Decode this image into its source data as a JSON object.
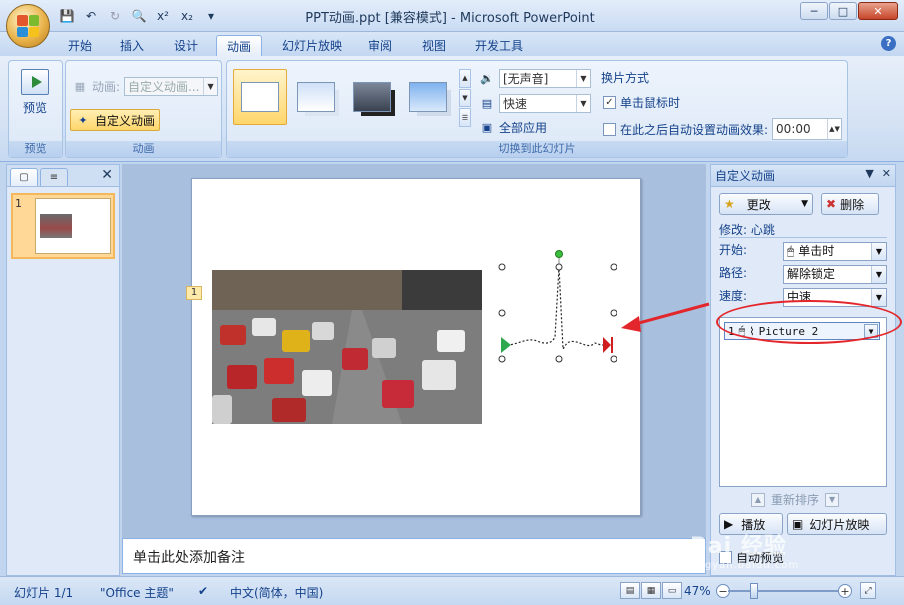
{
  "window": {
    "title": "PPT动画.ppt [兼容模式] - Microsoft PowerPoint",
    "controls": [
      "─",
      "□",
      "✕"
    ]
  },
  "qat": {
    "items": [
      "save-icon",
      "undo-icon",
      "redo-icon",
      "print-preview-icon",
      "superscript-icon",
      "subscript-icon",
      "customize-icon"
    ],
    "superscript": "x²",
    "subscript": "x₂"
  },
  "tabs": [
    "开始",
    "插入",
    "设计",
    "动画",
    "幻灯片放映",
    "审阅",
    "视图",
    "开发工具"
  ],
  "active_tab": "动画",
  "ribbon": {
    "preview_group": {
      "button": "预览",
      "label": "预览"
    },
    "animation_group": {
      "label": "动画",
      "animate_label": "动画:",
      "animate_value": "自定义动画...",
      "custom_animation_button": "自定义动画"
    },
    "transition_group": {
      "label": "切换到此幻灯片",
      "sound": "[无声音]",
      "speed": "快速",
      "apply_all": "全部应用",
      "advance_title": "换片方式",
      "on_click": "单击鼠标时",
      "on_click_checked": true,
      "after_label": "在此之后自动设置动画效果:",
      "after_value": "00:00",
      "after_checked": false
    }
  },
  "slides_pane": {
    "slide_number": "1"
  },
  "slide": {
    "animation_marker": "1"
  },
  "notes": {
    "placeholder": "单击此处添加备注"
  },
  "custom_animation_pane": {
    "title": "自定义动画",
    "change_button": "更改",
    "remove_button": "删除",
    "modify_label": "修改: 心跳",
    "start_label": "开始:",
    "start_value": "单击时",
    "path_label": "路径:",
    "path_value": "解除锁定",
    "speed_label": "速度:",
    "speed_value": "中速",
    "list_item": {
      "index": "1",
      "name": "Picture 2"
    },
    "reorder_label": "重新排序",
    "play_button": "播放",
    "slideshow_button": "幻灯片放映",
    "auto_preview_label": "自动预览"
  },
  "statusbar": {
    "slide_info": "幻灯片 1/1",
    "theme": "\"Office 主题\"",
    "language": "中文(简体，中国)",
    "zoom": "47%"
  },
  "watermark": {
    "text": "Bai 经验",
    "sub": "jingyan.baidu.com"
  },
  "colors": {
    "accent": "#15428b",
    "ribbon_bg": "#dce8f7",
    "highlight": "#ffd66b",
    "annotation_red": "#e3262b",
    "path_start": "#2fa84f",
    "path_end": "#d01e1e"
  }
}
